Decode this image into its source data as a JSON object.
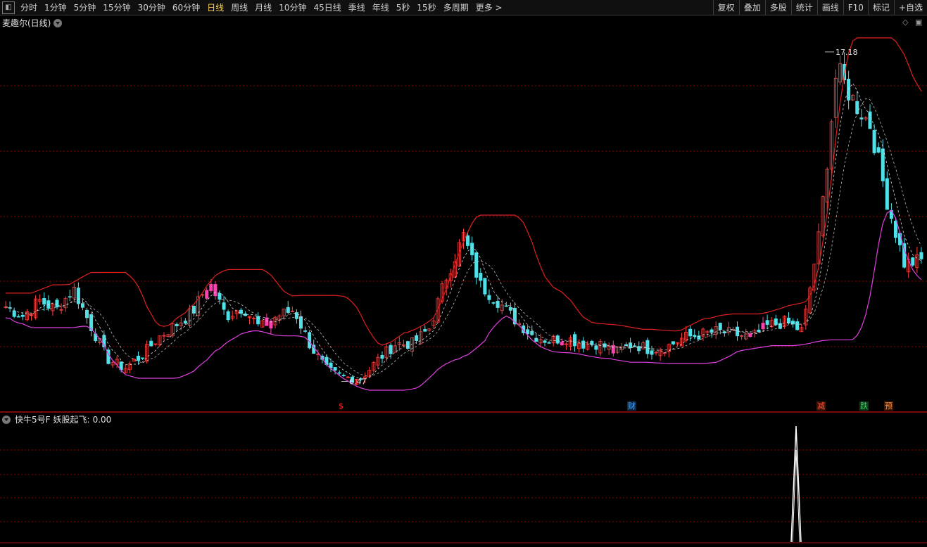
{
  "toolbar": {
    "periods": [
      "分时",
      "1分钟",
      "5分钟",
      "15分钟",
      "30分钟",
      "60分钟",
      "日线",
      "周线",
      "月线",
      "10分钟",
      "45日线",
      "季线",
      "年线",
      "5秒",
      "15秒",
      "多周期",
      "更多 >"
    ],
    "active_period": "日线",
    "right_buttons": [
      "复权",
      "叠加",
      "多股",
      "统计",
      "画线",
      "F10",
      "标记",
      "+自选"
    ]
  },
  "main_panel": {
    "title": "麦趣尔(日线)",
    "high_label": "17.18",
    "low_label": "6.47",
    "badges": [
      {
        "text": "$",
        "color": "#ff3030"
      },
      {
        "text": "财",
        "color": "#4aa8ff"
      },
      {
        "text": "减",
        "color": "#ff5040"
      },
      {
        "text": "跌",
        "color": "#30d060"
      },
      {
        "text": "预",
        "color": "#ff9040"
      }
    ]
  },
  "sub_panel": {
    "title": "快牛5号F",
    "indicator_label": "妖股起飞:",
    "indicator_value": "0.00"
  },
  "colors": {
    "up": "#ff4040",
    "down": "#50e0e8",
    "band_upper": "#e02020",
    "band_lower": "#e040e0",
    "grid": "#8b0000",
    "signal": "#ffffff"
  },
  "chart_data": {
    "type": "candlestick",
    "price_range": [
      5.5,
      18.0
    ],
    "annotations": [
      {
        "text": "17.18",
        "value": 17.18
      },
      {
        "text": "6.47",
        "value": 6.47
      }
    ],
    "close_path": [
      8.9,
      8.6,
      9.1,
      8.8,
      9.5,
      8.3,
      7.2,
      6.9,
      7.3,
      7.9,
      8.3,
      8.7,
      9.7,
      8.6,
      8.9,
      8.2,
      8.6,
      8.8,
      7.6,
      6.8,
      6.6,
      6.6,
      7.2,
      7.7,
      7.7,
      8.2,
      9.9,
      11.2,
      9.6,
      9.1,
      8.5,
      8.0,
      7.8,
      7.9,
      7.7,
      7.7,
      7.4,
      7.7,
      7.5,
      7.6,
      7.9,
      8.0,
      8.1,
      8.0,
      7.9,
      8.3,
      8.4,
      8.1,
      11.3,
      16.6,
      15.6,
      14.8,
      12.3,
      10.3,
      10.4
    ]
  }
}
